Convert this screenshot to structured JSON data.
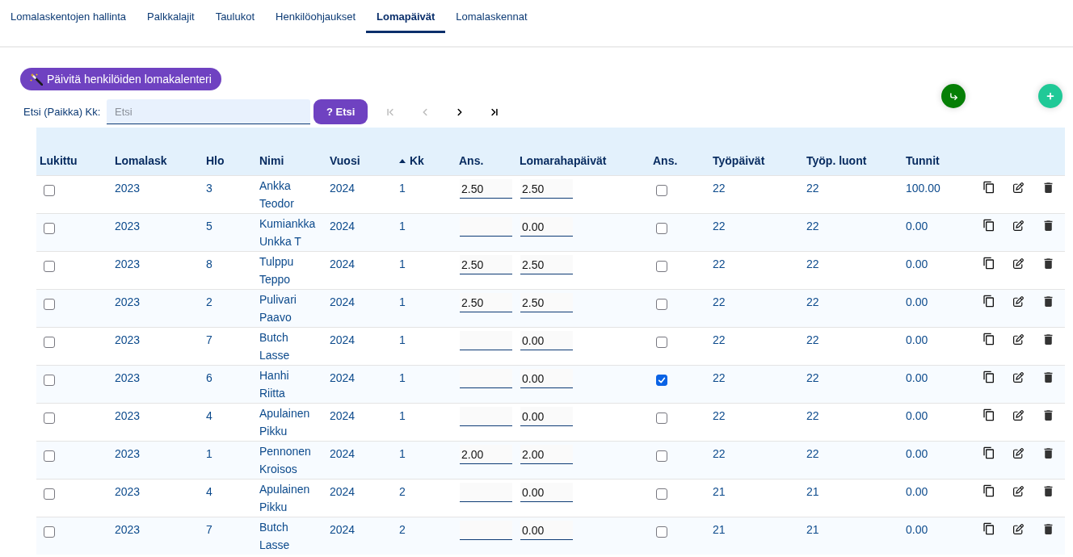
{
  "tabs": [
    {
      "label": "Lomalaskentojen hallinta",
      "selected": false
    },
    {
      "label": "Palkkalajit",
      "selected": false
    },
    {
      "label": "Taulukot",
      "selected": false
    },
    {
      "label": "Henkilöohjaukset",
      "selected": false
    },
    {
      "label": "Lomapäivät",
      "selected": true
    },
    {
      "label": "Lomalaskennat",
      "selected": false
    }
  ],
  "update_button": {
    "label": "Päivitä henkilöiden lomakalenteri"
  },
  "search": {
    "label": "Etsi (Paikka) Kk:",
    "placeholder": "Etsi",
    "button": "? Etsi"
  },
  "pagination": [
    {
      "kind": "first",
      "disabled": true
    },
    {
      "kind": "previous",
      "disabled": true
    },
    {
      "kind": "next",
      "disabled": false
    },
    {
      "kind": "last",
      "disabled": false
    }
  ],
  "round_buttons": [
    {
      "kind": "return"
    },
    {
      "kind": "add"
    }
  ],
  "table": {
    "columns": [
      {
        "label": "Lukittu"
      },
      {
        "label": "Lomalask"
      },
      {
        "label": "Hlo"
      },
      {
        "label": "Nimi"
      },
      {
        "label": "Vuosi"
      },
      {
        "label": "Kk",
        "sorted": true
      },
      {
        "label": "Ans."
      },
      {
        "label": "Lomarahapäivät"
      },
      {
        "label": "Ans."
      },
      {
        "label": "Työpäivät"
      },
      {
        "label": "Työp. luont"
      },
      {
        "label": "Tunnit"
      }
    ],
    "rows": [
      {
        "locked": false,
        "lomalask": "2023",
        "hlo": "3",
        "nimi": "Ankka Teodor",
        "vuosi": "2024",
        "kk": "1",
        "ans": "2.50",
        "lomarahapaivat": "2.50",
        "ans_checked": false,
        "tyopaivat": "22",
        "tyop_luont": "22",
        "tunnit": "100.00"
      },
      {
        "locked": false,
        "lomalask": "2023",
        "hlo": "5",
        "nimi": "Kumiankka Unkka T",
        "vuosi": "2024",
        "kk": "1",
        "lomarahapaivat": "0.00",
        "ans_checked": false,
        "tyopaivat": "22",
        "tyop_luont": "22",
        "tunnit": "0.00"
      },
      {
        "locked": false,
        "lomalask": "2023",
        "hlo": "8",
        "nimi": "Tulppu Teppo",
        "vuosi": "2024",
        "kk": "1",
        "ans": "2.50",
        "lomarahapaivat": "2.50",
        "ans_checked": false,
        "tyopaivat": "22",
        "tyop_luont": "22",
        "tunnit": "0.00"
      },
      {
        "locked": false,
        "lomalask": "2023",
        "hlo": "2",
        "nimi": "Pulivari Paavo",
        "vuosi": "2024",
        "kk": "1",
        "ans": "2.50",
        "lomarahapaivat": "2.50",
        "ans_checked": false,
        "tyopaivat": "22",
        "tyop_luont": "22",
        "tunnit": "0.00"
      },
      {
        "locked": false,
        "lomalask": "2023",
        "hlo": "7",
        "nimi": "Butch Lasse",
        "vuosi": "2024",
        "kk": "1",
        "lomarahapaivat": "0.00",
        "ans_checked": false,
        "tyopaivat": "22",
        "tyop_luont": "22",
        "tunnit": "0.00"
      },
      {
        "locked": false,
        "lomalask": "2023",
        "hlo": "6",
        "nimi": "Hanhi Riitta",
        "vuosi": "2024",
        "kk": "1",
        "lomarahapaivat": "0.00",
        "ans_checked": true,
        "tyopaivat": "22",
        "tyop_luont": "22",
        "tunnit": "0.00"
      },
      {
        "locked": false,
        "lomalask": "2023",
        "hlo": "4",
        "nimi": "Apulainen Pikku",
        "vuosi": "2024",
        "kk": "1",
        "lomarahapaivat": "0.00",
        "ans_checked": false,
        "tyopaivat": "22",
        "tyop_luont": "22",
        "tunnit": "0.00"
      },
      {
        "locked": false,
        "lomalask": "2023",
        "hlo": "1",
        "nimi": "Pennonen Kroisos",
        "vuosi": "2024",
        "kk": "1",
        "ans": "2.00",
        "lomarahapaivat": "2.00",
        "ans_checked": false,
        "tyopaivat": "22",
        "tyop_luont": "22",
        "tunnit": "0.00"
      },
      {
        "locked": false,
        "lomalask": "2023",
        "hlo": "4",
        "nimi": "Apulainen Pikku",
        "vuosi": "2024",
        "kk": "2",
        "lomarahapaivat": "0.00",
        "ans_checked": false,
        "tyopaivat": "21",
        "tyop_luont": "21",
        "tunnit": "0.00"
      },
      {
        "locked": false,
        "lomalask": "2023",
        "hlo": "7",
        "nimi": "Butch Lasse",
        "vuosi": "2024",
        "kk": "2",
        "lomarahapaivat": "0.00",
        "ans_checked": false,
        "tyopaivat": "21",
        "tyop_luont": "21",
        "tunnit": "0.00"
      }
    ]
  }
}
